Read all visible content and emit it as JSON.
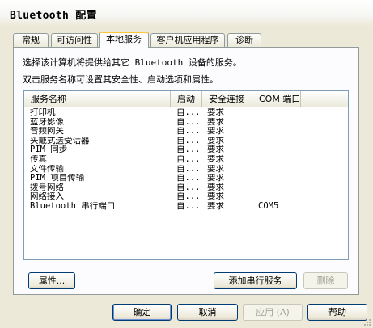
{
  "window": {
    "title": "Bluetooth 配置"
  },
  "tabs": [
    {
      "label": "常规"
    },
    {
      "label": "可访问性"
    },
    {
      "label": "本地服务",
      "active": true
    },
    {
      "label": "客户机应用程序"
    },
    {
      "label": "诊断"
    }
  ],
  "panel": {
    "description_line1": "选择该计算机将提供给其它 Bluetooth 设备的服务。",
    "description_line2": "双击服务名称可设置其安全性、启动选项和属性。"
  },
  "services_table": {
    "columns": [
      "服务名称",
      "启动",
      "安全连接",
      "COM 端口"
    ],
    "rows": [
      {
        "name": "打印机",
        "startup": "自...",
        "secure": "要求",
        "com": ""
      },
      {
        "name": "蓝牙影像",
        "startup": "自...",
        "secure": "要求",
        "com": ""
      },
      {
        "name": "音频网关",
        "startup": "自...",
        "secure": "要求",
        "com": ""
      },
      {
        "name": "头戴式送受话器",
        "startup": "自...",
        "secure": "要求",
        "com": ""
      },
      {
        "name": "PIM 同步",
        "startup": "自...",
        "secure": "要求",
        "com": ""
      },
      {
        "name": "传真",
        "startup": "自...",
        "secure": "要求",
        "com": ""
      },
      {
        "name": "文件传输",
        "startup": "自...",
        "secure": "要求",
        "com": ""
      },
      {
        "name": "PIM 项目传输",
        "startup": "自...",
        "secure": "要求",
        "com": ""
      },
      {
        "name": "拨号网络",
        "startup": "自...",
        "secure": "要求",
        "com": ""
      },
      {
        "name": "网络接入",
        "startup": "自...",
        "secure": "要求",
        "com": ""
      },
      {
        "name": "Bluetooth 串行端口",
        "startup": "自...",
        "secure": "要求",
        "com": "COM5"
      }
    ]
  },
  "panel_buttons": {
    "properties": "属性...",
    "add_serial": "添加串行服务",
    "delete": "删除"
  },
  "dialog_buttons": {
    "ok": "确定",
    "cancel": "取消",
    "apply": "应用 (A)",
    "help": "帮助"
  },
  "colors": {
    "dialog_bg": "#ece9d8",
    "panel_bg": "#fcfcfe",
    "button_border": "#003c74",
    "active_tab_accent": "#ffc83c",
    "disabled_text": "#a1a192"
  }
}
